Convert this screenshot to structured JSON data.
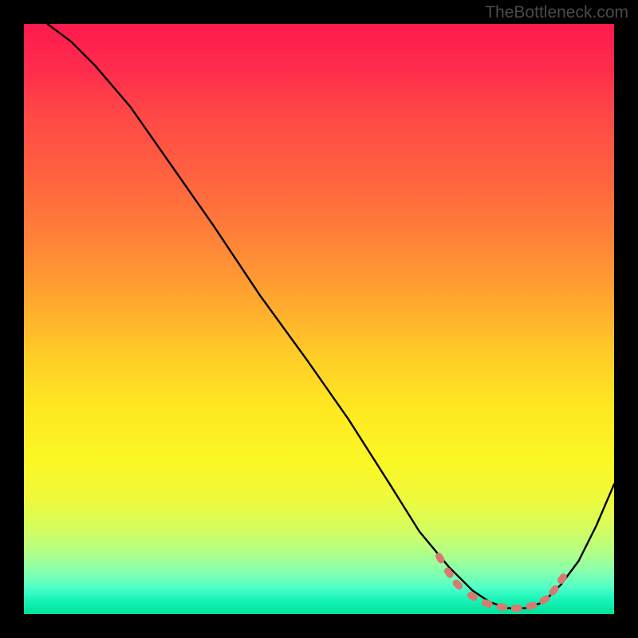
{
  "watermark": "TheBottleneck.com",
  "chart_data": {
    "type": "line",
    "title": "",
    "xlabel": "",
    "ylabel": "",
    "xlim": [
      0,
      100
    ],
    "ylim": [
      0,
      100
    ],
    "grid": false,
    "legend": false,
    "note": "Heatmap-style gradient background (red at top = high bottleneck, green at bottom = low/none). Black curve overlays showing bottleneck % vs. some index. Pink dotted markers cluster near the curve minimum. Numeric values are estimated from pixel positions; no axes/ticks shown.",
    "series": [
      {
        "name": "curve",
        "x": [
          4,
          8,
          12,
          18,
          25,
          32,
          40,
          48,
          55,
          62,
          67,
          72,
          76,
          79,
          82,
          85,
          88,
          91,
          94,
          97,
          100
        ],
        "y": [
          100,
          97,
          93,
          86,
          76,
          66,
          54,
          43,
          33,
          22,
          14,
          8,
          4,
          2,
          1,
          1,
          2,
          5,
          9,
          15,
          22
        ]
      }
    ],
    "markers": {
      "name": "highlight-dots",
      "points": [
        {
          "x": 70.5,
          "y": 9.5
        },
        {
          "x": 72.0,
          "y": 7.0
        },
        {
          "x": 73.5,
          "y": 5.0
        },
        {
          "x": 76.0,
          "y": 3.0
        },
        {
          "x": 78.5,
          "y": 1.8
        },
        {
          "x": 81.0,
          "y": 1.2
        },
        {
          "x": 83.5,
          "y": 1.0
        },
        {
          "x": 86.0,
          "y": 1.4
        },
        {
          "x": 88.2,
          "y": 2.4
        },
        {
          "x": 89.8,
          "y": 4.0
        },
        {
          "x": 91.2,
          "y": 6.0
        }
      ]
    }
  }
}
